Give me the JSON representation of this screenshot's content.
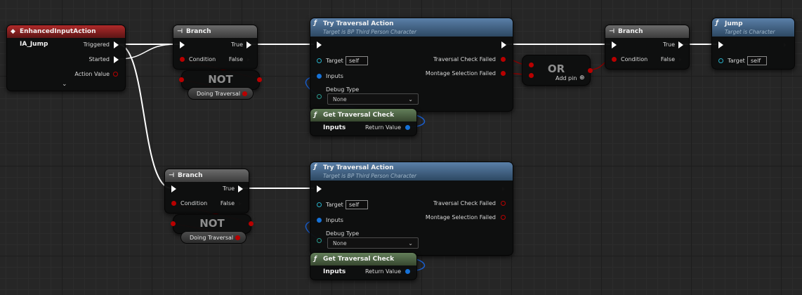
{
  "event_node": {
    "icon": "diamond-event-icon",
    "title": "EnhancedInputAction IA_Jump",
    "pins": {
      "triggered": "Triggered",
      "started": "Started",
      "action_value": "Action Value"
    },
    "collapse_icon": "chevron-down-icon"
  },
  "branch1": {
    "icon": "branch-icon",
    "title": "Branch",
    "true": "True",
    "condition": "Condition",
    "false": "False"
  },
  "not1": {
    "label": "NOT",
    "var": "Doing Traversal"
  },
  "try1": {
    "icon": "function-icon",
    "title": "Try Traversal Action",
    "subtitle": "Target is BP Third Person Character",
    "target": "Target",
    "self": "self",
    "inputs": "Inputs",
    "debug": "Debug Type",
    "debug_value": "None",
    "check_failed": "Traversal Check Failed",
    "montage_failed": "Montage Selection Failed"
  },
  "get1": {
    "icon": "function-icon",
    "title": "Get Traversal Check Inputs",
    "ret": "Return Value"
  },
  "or_node": {
    "label": "OR",
    "add_pin": "Add pin",
    "add_icon": "plus-circle-icon"
  },
  "branch2": {
    "icon": "branch-icon",
    "title": "Branch",
    "true": "True",
    "condition": "Condition",
    "false": "False"
  },
  "jump": {
    "icon": "function-icon",
    "title": "Jump",
    "subtitle": "Target is Character",
    "target": "Target",
    "self": "self"
  },
  "branch3": {
    "icon": "branch-icon",
    "title": "Branch",
    "true": "True",
    "condition": "Condition",
    "false": "False"
  },
  "not2": {
    "label": "NOT",
    "var": "Doing Traversal"
  },
  "try2": {
    "icon": "function-icon",
    "title": "Try Traversal Action",
    "subtitle": "Target is BP Third Person Character",
    "target": "Target",
    "self": "self",
    "inputs": "Inputs",
    "debug": "Debug Type",
    "debug_value": "None",
    "check_failed": "Traversal Check Failed",
    "montage_failed": "Montage Selection Failed"
  },
  "get2": {
    "icon": "function-icon",
    "title": "Get Traversal Check Inputs",
    "ret": "Return Value"
  },
  "colors": {
    "exec_wire": "#ffffff",
    "bool_wire": "#8f0000",
    "struct_wire": "#1a5fcf",
    "event_header": "#b02a2a",
    "function_header": "#4a6d93",
    "pure_header": "#55704c"
  }
}
